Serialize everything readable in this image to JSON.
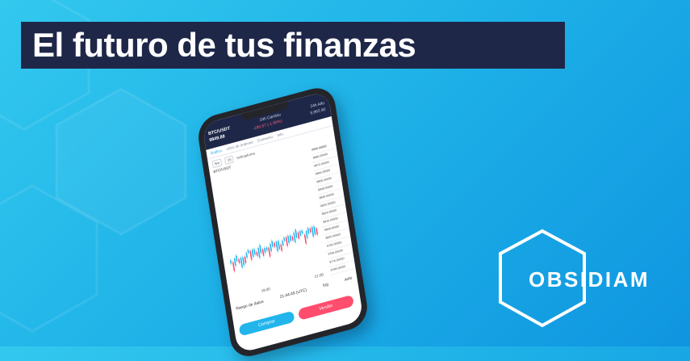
{
  "headline": {
    "text": "El futuro de tus finanzas"
  },
  "brand": {
    "name": "OBSIDIAM"
  },
  "colors": {
    "background": "#1fb3e8",
    "banner": "#1e2748",
    "buy": "#22b5ec",
    "sell": "#ff4d6d",
    "candle_up": "#22b5ec",
    "candle_down": "#ff4d6d"
  },
  "app": {
    "pair": "BTC/USDT",
    "price": "9849.88",
    "change_label": "24h Cambio",
    "change_value": "-180.87 (-1.80%)",
    "high_label": "24h Alto",
    "high_value": "9,962.90",
    "tabs": [
      "Gráfico",
      "Libro de órdenes",
      "Comercio",
      "Info"
    ],
    "tools": [
      "5m",
      "15",
      "Indicadores"
    ],
    "price_labels": [
      "9888.88888",
      "9880.00000",
      "9872.00000",
      "9864.00000",
      "9856.00000",
      "9848.00000",
      "9840.00000",
      "9832.00000",
      "9824.00000",
      "9816.00000",
      "9808.00000",
      "9800.00000",
      "9792.00000",
      "9784.00000",
      "9776.00000",
      "9768.00000"
    ],
    "time_labels": [
      "19:30",
      "21:00"
    ],
    "range_label": "Rango de datos",
    "clock": "21:44:49 (UTC)",
    "log_label": "log",
    "auto_label": "auto",
    "buy_label": "Comprar",
    "sell_label": "Vender"
  }
}
